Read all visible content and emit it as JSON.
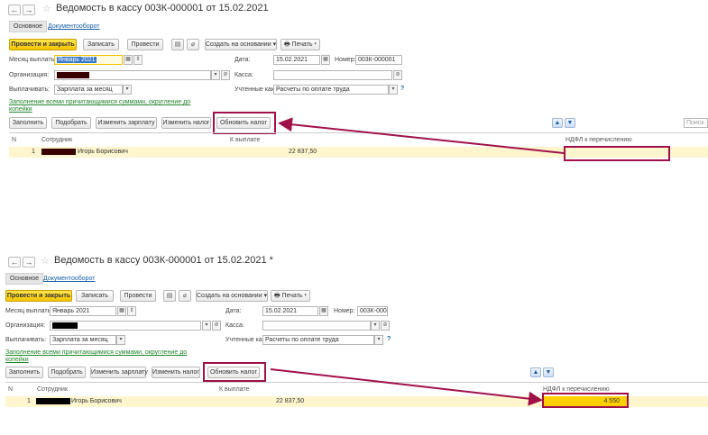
{
  "screens": [
    {
      "title": "Ведомость в кассу 003К-000001 от 15.02.2021",
      "tabs": [
        "Основное",
        "Документооборот"
      ],
      "toolbar": {
        "post_close": "Провести и закрыть",
        "save": "Записать",
        "post": "Провести",
        "create_based": "Создать на основании",
        "print": "Печать"
      },
      "fields": {
        "month_label": "Месяц выплаты:",
        "month_value": "Январь 2021",
        "date_label": "Дата:",
        "date_value": "15.02.2021",
        "number_label": "Номер:",
        "number_value": "003К-000001",
        "org_label": "Организация:",
        "cash_label": "Касса:",
        "pay_label": "Выплачивать:",
        "pay_value": "Зарплата за месяц",
        "accounted_label": "Учтенные как:",
        "accounted_value": "Расчеты по оплате труда",
        "help": "?"
      },
      "fill_link_1": "Заполнение всеми причитающимися суммами, округление до",
      "fill_link_2": "копейки",
      "table_toolbar": {
        "fill": "Заполнить",
        "pick": "Подобрать",
        "change_salary": "Изменить зарплату",
        "change_tax": "Изменить налог",
        "refresh_tax": "Обновить налог",
        "search": "Поиск"
      },
      "columns": {
        "n": "N",
        "employee": "Сотрудник",
        "to_pay": "К выплате",
        "ndfl": "НДФЛ к перечислению"
      },
      "rows": [
        {
          "n": "1",
          "employee": "Игорь Борисович",
          "to_pay": "22 837,50",
          "ndfl": ""
        }
      ]
    },
    {
      "title": "Ведомость в кассу 003К-000001 от 15.02.2021 *",
      "tabs": [
        "Основное",
        "Документооборот"
      ],
      "toolbar": {
        "post_close": "Провести и закрыть",
        "save": "Записать",
        "post": "Провести",
        "create_based": "Создать на основании",
        "print": "Печать"
      },
      "fields": {
        "month_label": "Месяц выплаты:",
        "month_value": "Январь 2021",
        "date_label": "Дата:",
        "date_value": "15.02.2021",
        "number_label": "Номер:",
        "number_value": "003К-000001",
        "org_label": "Организация:",
        "cash_label": "Касса:",
        "pay_label": "Выплачивать:",
        "pay_value": "Зарплата за месяц",
        "accounted_label": "Учтенные как:",
        "accounted_value": "Расчеты по оплате труда",
        "help": "?"
      },
      "fill_link_1": "Заполнение всеми причитающимися суммами, округление до",
      "fill_link_2": "копейки",
      "table_toolbar": {
        "fill": "Заполнить",
        "pick": "Подобрать",
        "change_salary": "Изменить зарплату",
        "change_tax": "Изменить налог",
        "refresh_tax": "Обновить налог"
      },
      "columns": {
        "n": "N",
        "employee": "Сотрудник",
        "to_pay": "К выплате",
        "ndfl": "НДФЛ к перечислению"
      },
      "rows": [
        {
          "n": "1",
          "employee": "Игорь Борисович",
          "to_pay": "22 837,50",
          "ndfl": "4 550"
        }
      ]
    }
  ],
  "colors": {
    "callout": "#a0114a",
    "primary_button": "#f5c400",
    "selected_row": "#fff6cf"
  }
}
